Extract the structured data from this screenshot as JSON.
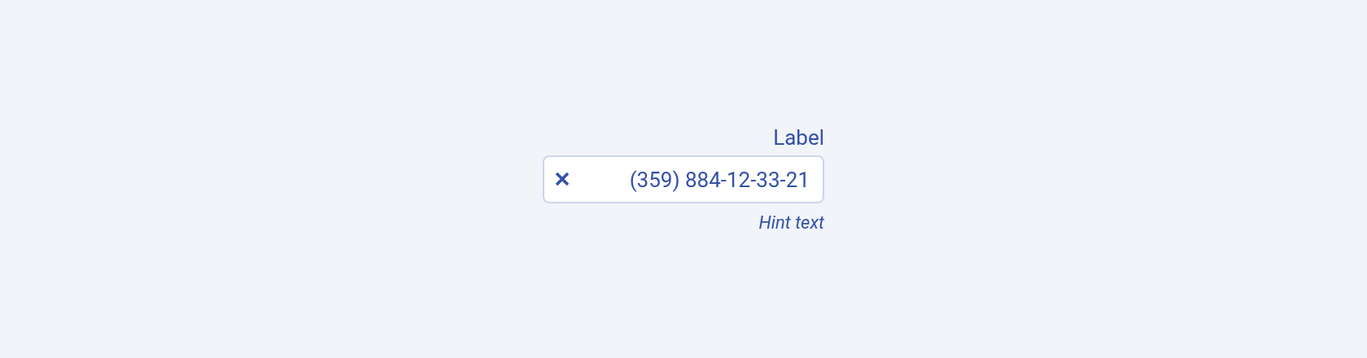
{
  "field": {
    "label": "Label",
    "value": "(359) 884-12-33-21",
    "hint": "Hint text"
  }
}
